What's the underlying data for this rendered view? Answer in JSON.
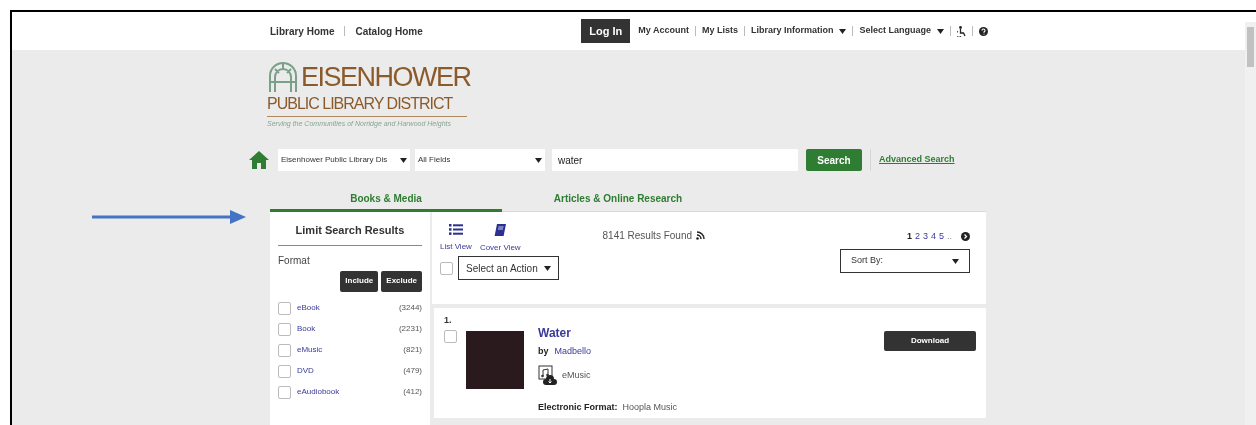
{
  "top_nav": {
    "left_links": [
      "Library Home",
      "Catalog Home"
    ],
    "login_button": "Log In",
    "right_links": [
      {
        "label": "My Account",
        "dropdown": false
      },
      {
        "label": "My Lists",
        "dropdown": false
      },
      {
        "label": "Library Information",
        "dropdown": true
      },
      {
        "label": "Select Language",
        "dropdown": true
      }
    ]
  },
  "logo": {
    "line_1": "EISENHOWER",
    "line_2": "PUBLIC LIBRARY DISTRICT",
    "tagline": "Serving the Communities of Norridge and Harwood Heights"
  },
  "search": {
    "library_select": "Eisenhower Public Library Dis",
    "field_select": "All Fields",
    "query": "water",
    "button": "Search",
    "advanced_link": "Advanced Search"
  },
  "tabs": [
    {
      "label": "Books & Media",
      "selected": true
    },
    {
      "label": "Articles & Online Research",
      "selected": false
    }
  ],
  "sidebar": {
    "title": "Limit Search Results",
    "facet": "Format",
    "include_button": "Include",
    "exclude_button": "Exclude",
    "items": [
      {
        "label": "eBook",
        "count": "(3244)",
        "checked": false
      },
      {
        "label": "Book",
        "count": "(2231)",
        "checked": false
      },
      {
        "label": "eMusic",
        "count": "(821)",
        "checked": false
      },
      {
        "label": "DVD",
        "count": "(479)",
        "checked": false
      },
      {
        "label": "eAudiobook",
        "count": "(412)",
        "checked": false
      }
    ]
  },
  "results": {
    "views": [
      {
        "label": "List View",
        "kind": "list"
      },
      {
        "label": "Cover View",
        "kind": "cover"
      }
    ],
    "count": "8141 Results Found",
    "pages": [
      {
        "label": "1",
        "selected": true
      },
      {
        "label": "2",
        "selected": false
      },
      {
        "label": "3",
        "selected": false
      },
      {
        "label": "4",
        "selected": false
      },
      {
        "label": "5",
        "selected": false
      }
    ],
    "pages_more": "..",
    "select_all_checked": false,
    "action_select": "Select an Action",
    "sort_select": "Sort By:",
    "items": [
      {
        "number": "1.",
        "checked": false,
        "title": "Water",
        "by": "by",
        "author": "Madbello",
        "format": "eMusic",
        "button": "Download",
        "details": [
          {
            "label": "Electronic Format:",
            "value": "Hoopla Music"
          }
        ]
      }
    ]
  }
}
